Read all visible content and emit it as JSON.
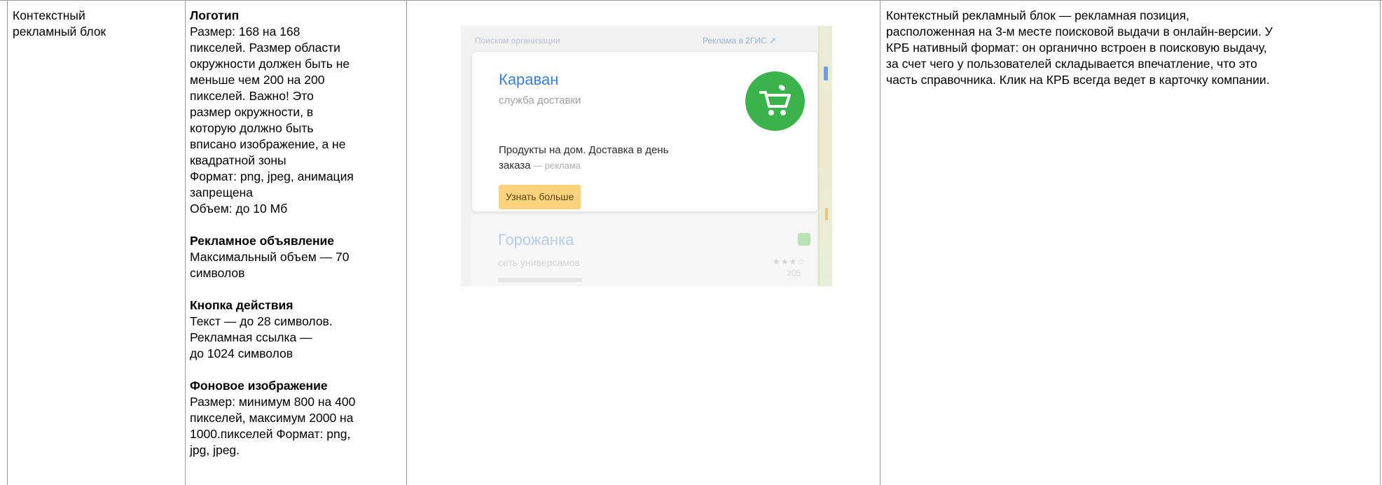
{
  "row": {
    "name": [
      "Контекстный",
      "рекламный блок"
    ],
    "description": [
      "Контекстный рекламный блок — рекламная позиция,",
      "расположенная на 3-м месте поисковой выдачи в онлайн-версии. У",
      "КРБ нативный формат: он органично встроен в поисковую выдачу,",
      "за счет чего у пользователей складывается впечатление, что это",
      "часть справочника. Клик на КРБ всегда ведет в карточку компании."
    ]
  },
  "requirements": {
    "logo": {
      "heading": "Логотип",
      "lines": [
        "Размер: 168 на 168",
        "пикселей. Размер области",
        "окружности должен быть не",
        "меньше чем 200 на 200",
        "пикселей. Важно! Это",
        "размер окружности, в",
        "которую должно быть",
        "вписано изображение, а не",
        "квадратной зоны",
        "Формат: png, jpeg, анимация",
        "запрещена",
        "Объем: до 10 Мб"
      ]
    },
    "ad": {
      "heading": "Рекламное объявление",
      "lines": [
        "Максимальный объем — 70",
        "символов"
      ]
    },
    "cta": {
      "heading": "Кнопка действия",
      "lines": [
        "Текст — до 28 символов.",
        "Рекламная ссылка —",
        "до 1024 символов"
      ]
    },
    "background": {
      "heading": "Фоновое изображение",
      "lines": [
        "Размер: минимум 800 на 400",
        "пикселей, максимум 2000 на",
        "1000.пикселей Формат: png,",
        "jpg, jpeg."
      ]
    }
  },
  "preview": {
    "topbar_left": "Поиском организации",
    "topbar_right": "Реклама в 2ГИС ↗",
    "card": {
      "title": "Караван",
      "subtitle": "служба доставки",
      "ad_text_1": "Продукты на дом. Доставка в день",
      "ad_text_2": "заказа",
      "ad_label": " — реклама",
      "cta": "Узнать больше"
    },
    "result2": {
      "title": "Горожанка",
      "subtitle": "сеть универсамов",
      "stars": "★★★☆",
      "count": "205"
    },
    "colors": {
      "accent_blue": "#3b7fd0",
      "logo_green": "#3bb34a",
      "cta_yellow": "#fcd27d"
    }
  }
}
